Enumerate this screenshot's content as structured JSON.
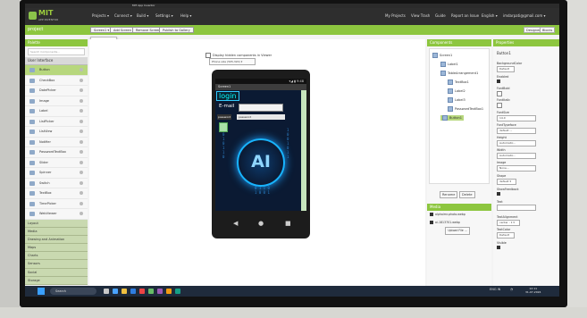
{
  "browser": {
    "tab_title": "MIT App Inventor"
  },
  "appbar": {
    "logo_title": "MIT",
    "logo_subtitle": "APP INVENTOR",
    "menus": [
      "Projects ▾",
      "Connect ▾",
      "Build ▾",
      "Settings ▾",
      "Help ▾"
    ],
    "right_menus": [
      "My Projects",
      "View Trash",
      "Guide",
      "Report an Issue",
      "English ▾",
      "imdarpati@gmail.com ▾"
    ]
  },
  "projbar": {
    "project_name": "project",
    "screen_select": "Screen1 ▾",
    "add_screen": "Add Screen ...",
    "remove_screen": "Remove Screen",
    "publish": "Publish to Gallery",
    "designer": "Designer",
    "blocks": "Blocks"
  },
  "dropdown": {
    "items": [
      "Screen1",
      "Screen2"
    ]
  },
  "palette": {
    "header": "Palette",
    "search_placeholder": "Search Components...",
    "category": "User Interface",
    "items": [
      "Button",
      "CheckBox",
      "DatePicker",
      "Image",
      "Label",
      "ListPicker",
      "ListView",
      "Notifier",
      "PasswordTextBox",
      "Slider",
      "Spinner",
      "Switch",
      "TextBox",
      "TimePicker",
      "WebViewer"
    ],
    "categories": [
      "Layout",
      "Media",
      "Drawing and Animation",
      "Maps",
      "Charts",
      "Sensors",
      "Social",
      "Storage"
    ]
  },
  "viewer": {
    "checkbox_label": "Display hidden components in Viewer",
    "size_select": "Phone size (505,320) ▾",
    "screen_title": "Screen1",
    "status_time": "▾◢ ▮ 9:48",
    "login_text": "login",
    "email_label": "E-mail",
    "password_label": "password",
    "password_value": "password",
    "ai_text": "AI",
    "nav_back": "◀",
    "nav_home": "●",
    "nav_recent": "■"
  },
  "components": {
    "header": "Components",
    "tree": [
      "Screen1",
      "Label1",
      "TableArrangement1",
      "TextBox1",
      "Label2",
      "Label3",
      "PasswordTextBox1",
      "Button1"
    ],
    "rename": "Rename",
    "delete": "Delete"
  },
  "media": {
    "header": "Media",
    "files": [
      "alphaimr-photo.webp",
      "ai-1813701.webp"
    ],
    "upload": "Upload File ..."
  },
  "properties": {
    "header": "Properties",
    "component": "Button1",
    "rows": [
      {
        "label": "BackgroundColor",
        "value": "Default"
      },
      {
        "label": "Enabled",
        "value": ""
      },
      {
        "label": "FontBold",
        "value": ""
      },
      {
        "label": "FontItalic",
        "value": ""
      },
      {
        "label": "FontSize",
        "value": "14.0"
      },
      {
        "label": "FontTypeface",
        "value": "default ..."
      },
      {
        "label": "Height",
        "value": "Automatic..."
      },
      {
        "label": "Width",
        "value": "Automatic..."
      },
      {
        "label": "Image",
        "value": "None..."
      },
      {
        "label": "Shape",
        "value": "default ▾"
      },
      {
        "label": "ShowFeedback",
        "value": ""
      },
      {
        "label": "Text",
        "value": ""
      },
      {
        "label": "TextAlignment",
        "value": "center : 1 ▾"
      },
      {
        "label": "TextColor",
        "value": "Default"
      },
      {
        "label": "Visible",
        "value": ""
      }
    ]
  },
  "taskbar": {
    "search": "Search",
    "lang": "ENG IN",
    "time": "12:11",
    "date": "31-07-2024"
  }
}
